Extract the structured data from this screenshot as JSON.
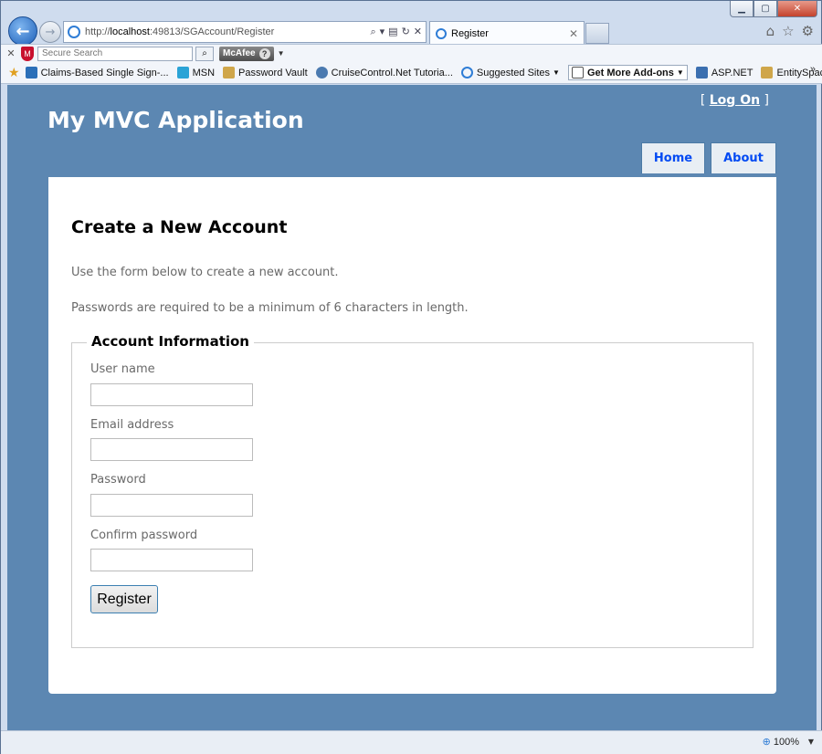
{
  "browser": {
    "address": {
      "prefix": "http://",
      "host": "localhost",
      "rest": ":49813/SGAccount/Register"
    },
    "tab_title": "Register",
    "search_placeholder": "Secure Search",
    "mcafee_label": "McAfee",
    "favorites": [
      {
        "label": "Claims-Based Single Sign-...",
        "icon": "claims-icon",
        "color": "#2b6fb8"
      },
      {
        "label": "MSN",
        "icon": "msn-icon",
        "color": "#2aa3d6"
      },
      {
        "label": "Password Vault",
        "icon": "page-icon",
        "color": "#cfa64a"
      },
      {
        "label": "CruiseControl.Net Tutoria...",
        "icon": "wordpress-icon",
        "color": "#4b7ab0"
      },
      {
        "label": "Suggested Sites",
        "icon": "ie-icon",
        "color": "#2f7dd6",
        "dropdown": true
      },
      {
        "label": "Get More Add-ons",
        "icon": "addons-icon",
        "color": "#555555",
        "dropdown": true,
        "boxed": true
      },
      {
        "label": "ASP.NET",
        "icon": "aspnet-icon",
        "color": "#3b6fb0"
      },
      {
        "label": "EntitySpaces",
        "icon": "page-icon",
        "color": "#cfa64a"
      }
    ],
    "zoom": "100%"
  },
  "site": {
    "title": "My MVC Application",
    "logon_open": "[",
    "logon_link": "Log On",
    "logon_close": "]",
    "menu": [
      "Home",
      "About"
    ]
  },
  "page": {
    "heading": "Create a New Account",
    "intro": "Use the form below to create a new account.",
    "password_rule": "Passwords are required to be a minimum of 6 characters in length.",
    "fieldset_legend": "Account Information",
    "fields": {
      "username_label": "User name",
      "email_label": "Email address",
      "password_label": "Password",
      "confirm_label": "Confirm password"
    },
    "submit_label": "Register"
  },
  "colors": {
    "site_background": "#5c87b2",
    "menu_link": "#034af3",
    "muted_text": "#696969"
  }
}
